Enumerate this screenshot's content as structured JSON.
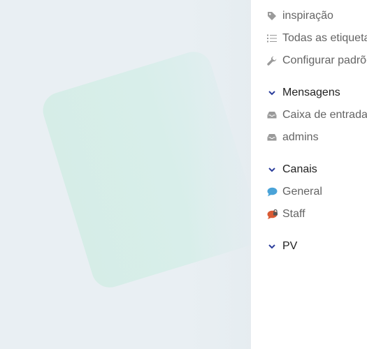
{
  "sidebar": {
    "tag_items": [
      {
        "label": "inspiração",
        "icon": "tag-icon"
      },
      {
        "label": "Todas as etiquetas",
        "icon": "list-icon"
      },
      {
        "label": "Configurar padrões",
        "icon": "wrench-icon"
      }
    ],
    "messages_section": {
      "title": "Mensagens",
      "items": [
        {
          "label": "Caixa de entrada",
          "icon": "inbox-icon"
        },
        {
          "label": "admins",
          "icon": "inbox-icon"
        }
      ]
    },
    "channels_section": {
      "title": "Canais",
      "items": [
        {
          "label": "General",
          "icon": "chat-bubble-icon",
          "color": "#4aa3d8"
        },
        {
          "label": "Staff",
          "icon": "chat-bubble-icon",
          "color": "#d95b35",
          "locked": true
        }
      ]
    },
    "pv_section": {
      "title": "PV"
    },
    "colors": {
      "chevron": "#2c3e9c",
      "icon_gray": "#9a9a9a",
      "label_gray": "#646464",
      "heading": "#222222"
    }
  }
}
